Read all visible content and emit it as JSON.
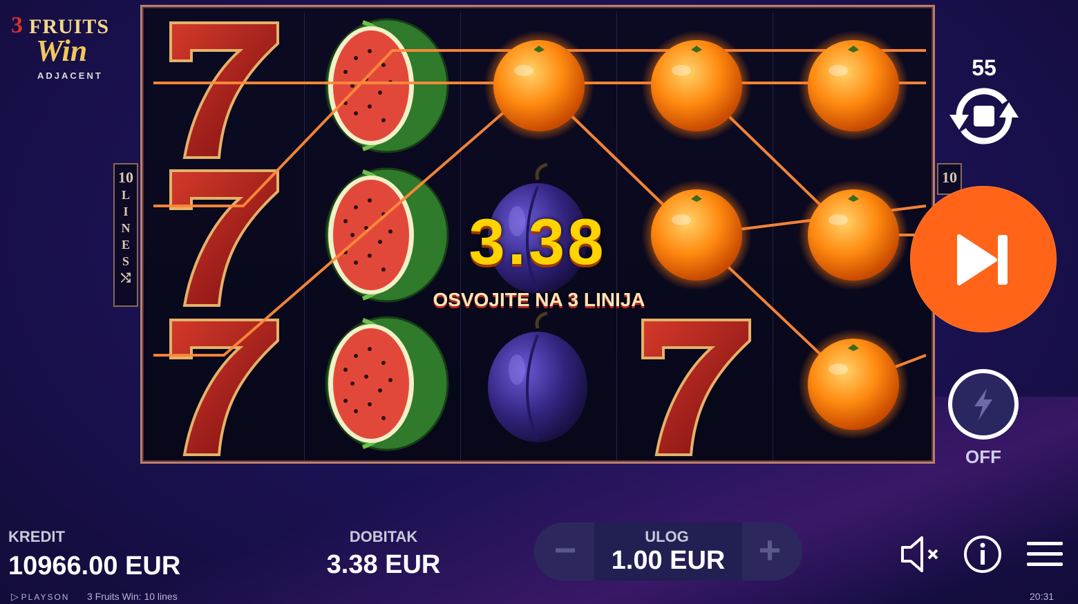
{
  "game": {
    "logo": {
      "num": "3",
      "word1": "FRUITS",
      "word2": "Win",
      "word3": "ADJACENT"
    },
    "lines_badge": {
      "count": "10",
      "letters": [
        "L",
        "I",
        "N",
        "E",
        "S"
      ]
    },
    "lines_badge_right": "10",
    "win_amount": "3.38",
    "win_message": "OSVOJITE NA 3 LINIJA",
    "reels": [
      [
        "seven-icon",
        "seven-icon",
        "seven-icon"
      ],
      [
        "watermelon-icon",
        "watermelon-icon",
        "watermelon-icon"
      ],
      [
        "orange-icon",
        "plum-icon",
        "plum-icon"
      ],
      [
        "orange-icon",
        "orange-icon",
        "seven-icon"
      ],
      [
        "orange-icon",
        "orange-icon",
        "orange-icon"
      ]
    ]
  },
  "controls": {
    "autoplay_count": "55",
    "turbo_state": "OFF"
  },
  "bottom_bar": {
    "credit_label": "KREDIT",
    "credit_value": "10966.00 EUR",
    "win_label": "DOBITAK",
    "win_value": "3.38 EUR",
    "bet_label": "ULOG",
    "bet_value": "1.00 EUR",
    "bet_minus": "−",
    "bet_plus": "+"
  },
  "footer": {
    "provider": "PLAYSON",
    "game_title": "3 Fruits Win: 10 lines",
    "clock": "20:31"
  },
  "colors": {
    "accent": "#ff6419",
    "win_gold": "#ffd400",
    "payline": "#ff8a3a"
  }
}
